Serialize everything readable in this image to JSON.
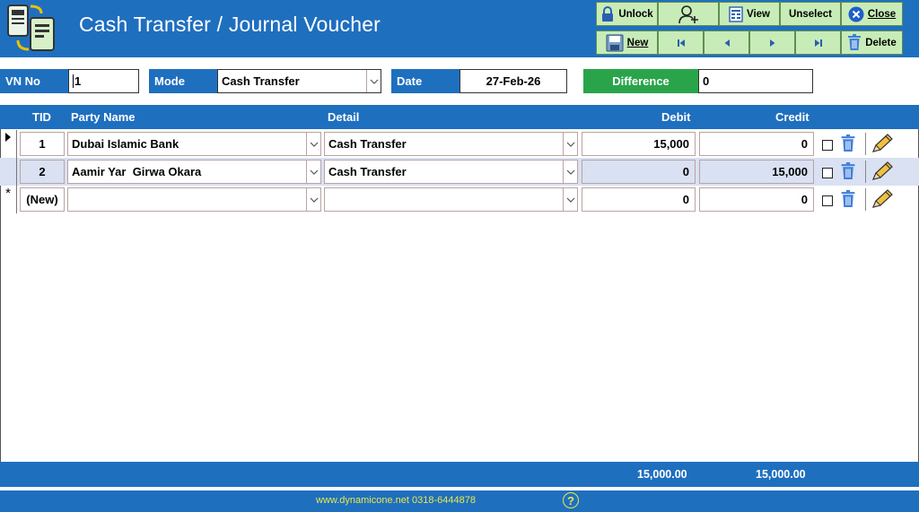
{
  "header": {
    "title": "Cash Transfer / Journal Voucher"
  },
  "toolbar": {
    "unlock": "Unlock",
    "view": "View",
    "unselect": "Unselect",
    "close": "Close",
    "new": "New",
    "delete": "Delete"
  },
  "form": {
    "vn_label": "VN No",
    "vn_value": "1",
    "mode_label": "Mode",
    "mode_value": "Cash Transfer",
    "date_label": "Date",
    "date_value": "27-Feb-26",
    "difference_label": "Difference",
    "difference_value": "0"
  },
  "table": {
    "columns": [
      "TID",
      "Party Name",
      "Detail",
      "Debit",
      "Credit"
    ],
    "rows": [
      {
        "tid": "1",
        "party": "Dubai Islamic Bank",
        "detail": "Cash Transfer",
        "debit": "15,000",
        "credit": "0"
      },
      {
        "tid": "2",
        "party": "Aamir Yar  Girwa Okara",
        "detail": "Cash Transfer",
        "debit": "0",
        "credit": "15,000"
      },
      {
        "tid": "(New)",
        "party": "",
        "detail": "",
        "debit": "0",
        "credit": "0"
      }
    ],
    "new_row_marker": "*"
  },
  "totals": {
    "debit": "15,000.00",
    "credit": "15,000.00"
  },
  "status": {
    "website": "www.dynamicone.net 0318-6444878",
    "help": "?"
  },
  "colors": {
    "primary": "#1f6fbf",
    "button": "#c8ecb8",
    "difference": "#2aa44b",
    "alt_row": "#d9e1f2"
  }
}
